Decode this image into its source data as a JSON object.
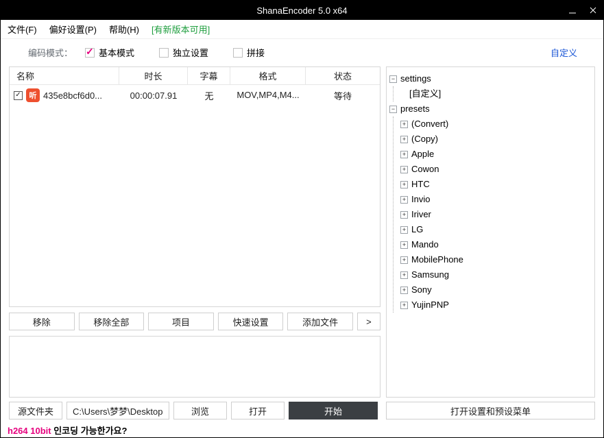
{
  "title": "ShanaEncoder 5.0 x64",
  "menu": {
    "file": "文件(F)",
    "pref": "偏好设置(P)",
    "help": "帮助(H)",
    "update": "[有新版本可用]"
  },
  "modebar": {
    "label": "编码模式：",
    "basic": "基本模式",
    "indep": "独立设置",
    "stitch": "拼接",
    "custom": "自定义"
  },
  "table": {
    "headers": {
      "name": "名称",
      "duration": "时长",
      "subtitle": "字幕",
      "format": "格式",
      "status": "状态"
    },
    "rows": [
      {
        "checked": true,
        "icon": "听",
        "name": "435e8bcf6d0...",
        "duration": "00:00:07.91",
        "subtitle": "无",
        "format": "MOV,MP4,M4...",
        "status": "等待"
      }
    ]
  },
  "buttons_row": {
    "remove": "移除",
    "remove_all": "移除全部",
    "project": "项目",
    "quick": "快速设置",
    "add": "添加文件",
    "more": ">"
  },
  "tree": {
    "settings": {
      "label": "settings",
      "children": [
        {
          "label": "[自定义]"
        }
      ]
    },
    "presets": {
      "label": "presets",
      "children": [
        {
          "label": "(Convert)"
        },
        {
          "label": "(Copy)"
        },
        {
          "label": "Apple"
        },
        {
          "label": "Cowon"
        },
        {
          "label": "HTC"
        },
        {
          "label": "Invio"
        },
        {
          "label": "Iriver"
        },
        {
          "label": "LG"
        },
        {
          "label": "Mando"
        },
        {
          "label": "MobilePhone"
        },
        {
          "label": "Samsung"
        },
        {
          "label": "Sony"
        },
        {
          "label": "YujinPNP"
        }
      ]
    }
  },
  "bottom": {
    "srcfolder": "源文件夹",
    "path": "C:\\Users\\梦梦\\Desktop",
    "browse": "浏览",
    "open": "打开",
    "start": "开始",
    "open_settings": "打开设置和预设菜单"
  },
  "status": {
    "bold": "h264 10bit",
    "rest": " 인코딩 가능한가요?"
  }
}
